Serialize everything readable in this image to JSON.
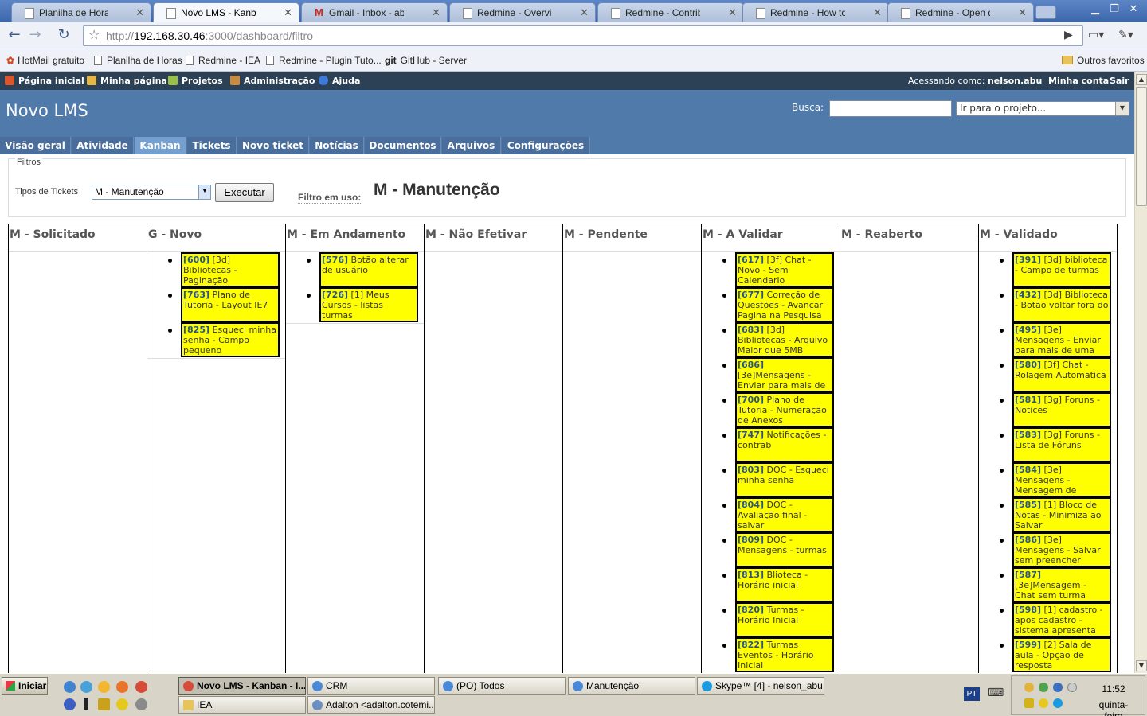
{
  "browser": {
    "tabs": [
      {
        "title": "Planilha de Horas | Planil...",
        "icon": "page-icon"
      },
      {
        "title": "Novo LMS - Kanban - IEA...",
        "icon": "page-icon"
      },
      {
        "title": "Gmail - Inbox - abuzitos...",
        "icon": "gmail-icon"
      },
      {
        "title": "Redmine - Overview - Re...",
        "icon": "page-icon"
      },
      {
        "title": "Redmine - Contribute - R...",
        "icon": "page-icon"
      },
      {
        "title": "Redmine - How to contrib...",
        "icon": "page-icon"
      },
      {
        "title": "Redmine - Open discussi...",
        "icon": "page-icon"
      }
    ],
    "url_scheme": "http://",
    "url_host": "192.168.30.46",
    "url_rest": ":3000/dashboard/filtro",
    "bookmarks": [
      "HotMail gratuito",
      "Planilha de Horas",
      "Redmine - IEA",
      "Redmine - Plugin Tuto...",
      "GitHub - Server"
    ],
    "bookmarks_other": "Outros favoritos",
    "git_label": "git"
  },
  "top_menu": {
    "items": [
      "Página inicial",
      "Minha página",
      "Projetos",
      "Administração",
      "Ajuda"
    ],
    "logged_as_label": "Acessando como:",
    "user": "nelson.abu",
    "account": "Minha conta",
    "logout": "Sair"
  },
  "header": {
    "title": "Novo LMS",
    "search_label": "Busca:",
    "jump_placeholder": "Ir para o projeto..."
  },
  "main_menu": [
    "Visão geral",
    "Atividade",
    "Kanban",
    "Tickets",
    "Novo ticket",
    "Notícias",
    "Documentos",
    "Arquivos",
    "Configurações"
  ],
  "filters": {
    "legend": "Filtros",
    "types_label": "Tipos de Tickets",
    "types_value": "M - Manutenção",
    "execute_label": "Executar",
    "in_use_label": "Filtro em uso:",
    "in_use_value": "M - Manutenção"
  },
  "board": {
    "columns": [
      {
        "title": "M - Solicitado",
        "cards": []
      },
      {
        "title": "G - Novo",
        "cards": [
          {
            "id": "[600]",
            "text": " [3d] Bibliotecas - Paginação"
          },
          {
            "id": "[763]",
            "text": " Plano de Tutoria - Layout IE7"
          },
          {
            "id": "[825]",
            "text": " Esqueci minha senha - Campo pequeno"
          }
        ]
      },
      {
        "title": "M - Em Andamento",
        "cards": [
          {
            "id": "[576]",
            "text": " Botão alterar de usuário"
          },
          {
            "id": "[726]",
            "text": " [1] Meus Cursos - listas turmas"
          }
        ]
      },
      {
        "title": "M - Não Efetivar",
        "cards": []
      },
      {
        "title": "M - Pendente",
        "cards": []
      },
      {
        "title": "M - A Validar",
        "cards": [
          {
            "id": "[617]",
            "text": " [3f] Chat - Novo - Sem Calendario"
          },
          {
            "id": "[677]",
            "text": " Correção de Questões - Avançar Pagina na Pesquisa"
          },
          {
            "id": "[683]",
            "text": " [3d] Bibliotecas - Arquivo Maior que 5MB"
          },
          {
            "id": "[686]",
            "text": " [3e]Mensagens - Enviar para mais de"
          },
          {
            "id": "[700]",
            "text": " Plano de Tutoria - Numeração de Anexos"
          },
          {
            "id": "[747]",
            "text": " Notificações - contrab"
          },
          {
            "id": "[803]",
            "text": " DOC - Esqueci minha senha"
          },
          {
            "id": "[804]",
            "text": " DOC - Avaliação final - salvar"
          },
          {
            "id": "[809]",
            "text": " DOC - Mensagens - turmas"
          },
          {
            "id": "[813]",
            "text": " Blioteca - Horário inicial"
          },
          {
            "id": "[820]",
            "text": " Turmas - Horário Inicial"
          },
          {
            "id": "[822]",
            "text": " Turmas Eventos - Horário Inicial"
          }
        ]
      },
      {
        "title": "M - Reaberto",
        "cards": []
      },
      {
        "title": "M - Validado",
        "cards": [
          {
            "id": "[391]",
            "text": " [3d] biblioteca - Campo de turmas"
          },
          {
            "id": "[432]",
            "text": " [3d] Biblioteca - Botão voltar fora do"
          },
          {
            "id": "[495]",
            "text": " [3e] Mensagens - Enviar para mais de uma"
          },
          {
            "id": "[580]",
            "text": " [3f] Chat - Rolagem Automatica"
          },
          {
            "id": "[581]",
            "text": " [3g] Foruns - Notices"
          },
          {
            "id": "[583]",
            "text": " [3g] Foruns - Lista de Fóruns"
          },
          {
            "id": "[584]",
            "text": " [3e] Mensagens - Mensagem de"
          },
          {
            "id": "[585]",
            "text": " [1] Bloco de Notas - Minimiza ao Salvar"
          },
          {
            "id": "[586]",
            "text": " [3e] Mensagens - Salvar sem preencher"
          },
          {
            "id": "[587]",
            "text": " [3e]Mensagem - Chat sem turma"
          },
          {
            "id": "[598]",
            "text": " [1] cadastro - apos cadastro - sistema apresenta"
          },
          {
            "id": "[599]",
            "text": " [2] Sala de aula - Opção de resposta"
          }
        ]
      }
    ]
  },
  "taskbar": {
    "start_label": "Iniciar",
    "tasks_row1": [
      "Novo LMS - Kanban - I...",
      "CRM",
      "(PO) Todos",
      "Manutenção",
      "Skype™ [4] - nelson_abu"
    ],
    "tasks_row2": [
      "IEA",
      "Adalton <adalton.cotemi..."
    ],
    "language": "PT",
    "time": "11:52",
    "day": "quinta-feira"
  }
}
